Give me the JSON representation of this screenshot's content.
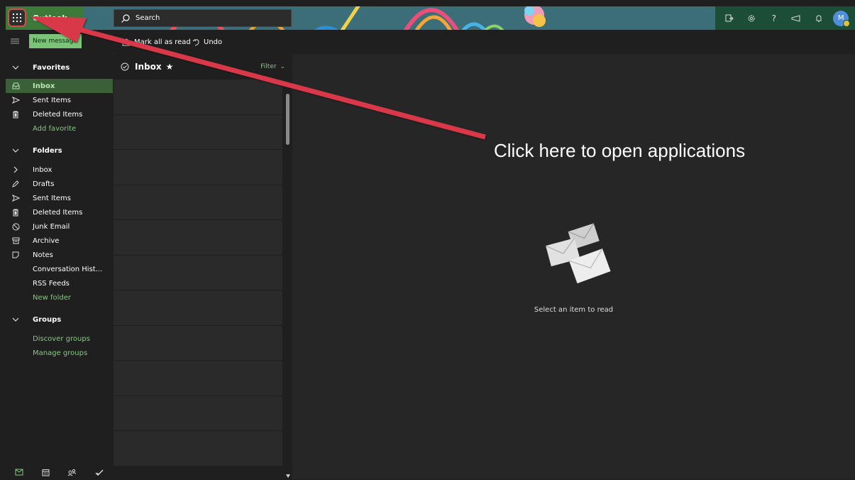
{
  "header": {
    "app_name": "Outlook",
    "search_label": "Search",
    "avatar_initial": "M",
    "tools": [
      "meet-icon",
      "gear-icon",
      "help-icon",
      "feedback-icon",
      "bell-icon"
    ],
    "help_glyph": "?"
  },
  "command_bar": {
    "new_message": "New message",
    "mark_all_read": "Mark all as read",
    "undo": "Undo"
  },
  "nav": {
    "favorites_header": "Favorites",
    "favorites": [
      {
        "label": "Inbox",
        "icon": "inbox-icon",
        "selected": true
      },
      {
        "label": "Sent Items",
        "icon": "send-icon"
      },
      {
        "label": "Deleted Items",
        "icon": "trash-icon"
      }
    ],
    "add_favorite": "Add favorite",
    "folders_header": "Folders",
    "folders": [
      {
        "label": "Inbox",
        "icon": "chevron-right-icon"
      },
      {
        "label": "Drafts",
        "icon": "pencil-icon"
      },
      {
        "label": "Sent Items",
        "icon": "send-icon"
      },
      {
        "label": "Deleted Items",
        "icon": "trash-icon"
      },
      {
        "label": "Junk Email",
        "icon": "block-icon"
      },
      {
        "label": "Archive",
        "icon": "archive-icon"
      },
      {
        "label": "Notes",
        "icon": "note-icon"
      },
      {
        "label": "Conversation Hist...",
        "icon": ""
      },
      {
        "label": "RSS Feeds",
        "icon": ""
      }
    ],
    "new_folder": "New folder",
    "groups_header": "Groups",
    "discover_groups": "Discover groups",
    "manage_groups": "Manage groups",
    "bottom_icons": [
      "mail-icon",
      "calendar-icon",
      "people-icon",
      "todo-icon"
    ]
  },
  "list": {
    "title": "Inbox",
    "star": "★",
    "filter": "Filter"
  },
  "reading": {
    "empty_text": "Select an item to read"
  },
  "annotation": {
    "callout": "Click here to open applications",
    "arrow_color": "#d9394a"
  },
  "colors": {
    "accent_green": "#7cc278",
    "link_green": "#84c97e",
    "selected_bg": "#3b5f37",
    "header_tools_bg": "#1c4d36"
  }
}
